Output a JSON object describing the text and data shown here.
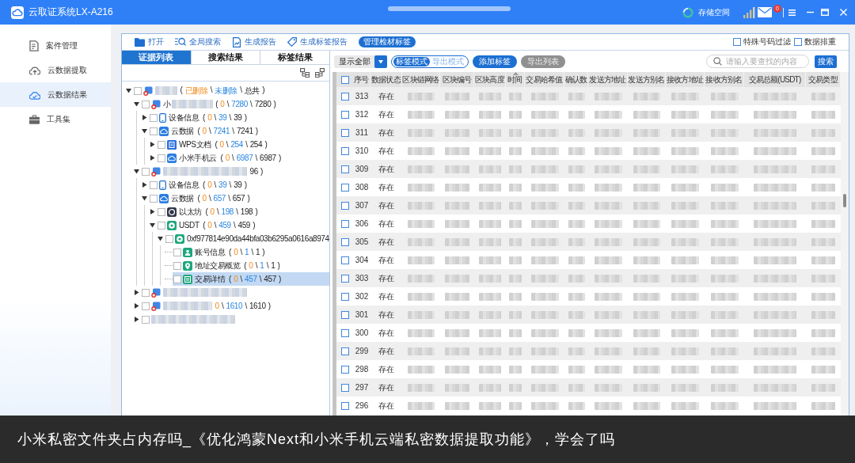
{
  "window": {
    "title": "云取证系统LX-A216",
    "storage_label": "存储空间",
    "mail_badge": "0"
  },
  "sidebar": {
    "items": [
      {
        "label": "案件管理",
        "kind": "case",
        "selected": false
      },
      {
        "label": "云数据提取",
        "kind": "upload",
        "selected": false
      },
      {
        "label": "云数据结果",
        "kind": "result",
        "selected": true
      },
      {
        "label": "工具集",
        "kind": "tools",
        "selected": false
      }
    ]
  },
  "toolbar": {
    "actions": [
      {
        "label": "打开",
        "kind": "open"
      },
      {
        "label": "全局搜索",
        "kind": "search"
      },
      {
        "label": "生成报告",
        "kind": "report"
      },
      {
        "label": "生成标签报告",
        "kind": "tag"
      }
    ],
    "tag_button": "管理检材标签",
    "options": [
      {
        "label": "特殊号码过滤",
        "checked": false
      },
      {
        "label": "数据排重",
        "checked": false
      }
    ]
  },
  "evidence_panel": {
    "tabs": [
      {
        "label": "证据列表",
        "selected": true
      },
      {
        "label": "搜索结果",
        "selected": false
      },
      {
        "label": "标签结果",
        "selected": false
      }
    ],
    "tree": [
      {
        "kind": "device",
        "redacted": true,
        "counts": [
          {
            "text": "(",
            "kind": "sep"
          },
          {
            "text": "已删除",
            "kind": "deleted"
          },
          {
            "text": "\\",
            "kind": "sep"
          },
          {
            "text": "未删除",
            "kind": "undeleted"
          },
          {
            "text": "\\",
            "kind": "sep"
          },
          {
            "text": "总共",
            "kind": "total"
          },
          {
            "text": ")",
            "kind": "sep"
          }
        ],
        "has_children": true,
        "expanded": true,
        "checked": false,
        "selected": false,
        "children": [
          {
            "kind": "device",
            "label": "小",
            "redacted": true,
            "counts": [
              {
                "text": "(",
                "kind": "sep"
              },
              {
                "text": "0",
                "kind": "deleted"
              },
              {
                "text": "\\",
                "kind": "sep"
              },
              {
                "text": "7280",
                "kind": "undeleted"
              },
              {
                "text": "\\",
                "kind": "sep"
              },
              {
                "text": "7280",
                "kind": "total"
              },
              {
                "text": ")",
                "kind": "sep"
              }
            ],
            "has_children": true,
            "expanded": true,
            "checked": false,
            "selected": false,
            "children": [
              {
                "kind": "phone",
                "label": "设备信息",
                "redacted": false,
                "counts": [
                  {
                    "text": "(",
                    "kind": "sep"
                  },
                  {
                    "text": "0",
                    "kind": "deleted"
                  },
                  {
                    "text": "\\",
                    "kind": "sep"
                  },
                  {
                    "text": "39",
                    "kind": "undeleted"
                  },
                  {
                    "text": "\\",
                    "kind": "sep"
                  },
                  {
                    "text": "39",
                    "kind": "total"
                  },
                  {
                    "text": ")",
                    "kind": "sep"
                  }
                ],
                "has_children": true,
                "expanded": false,
                "checked": false,
                "selected": false
              },
              {
                "kind": "cloud",
                "label": "云数据",
                "redacted": false,
                "counts": [
                  {
                    "text": "(",
                    "kind": "sep"
                  },
                  {
                    "text": "0",
                    "kind": "deleted"
                  },
                  {
                    "text": "\\",
                    "kind": "sep"
                  },
                  {
                    "text": "7241",
                    "kind": "undeleted"
                  },
                  {
                    "text": "\\",
                    "kind": "sep"
                  },
                  {
                    "text": "7241",
                    "kind": "total"
                  },
                  {
                    "text": ")",
                    "kind": "sep"
                  }
                ],
                "has_children": true,
                "expanded": true,
                "checked": false,
                "selected": false,
                "children": [
                  {
                    "kind": "document",
                    "label": "WPS文档",
                    "redacted": false,
                    "counts": [
                      {
                        "text": "(",
                        "kind": "sep"
                      },
                      {
                        "text": "0",
                        "kind": "deleted"
                      },
                      {
                        "text": "\\",
                        "kind": "sep"
                      },
                      {
                        "text": "254",
                        "kind": "undeleted"
                      },
                      {
                        "text": "\\",
                        "kind": "sep"
                      },
                      {
                        "text": "254",
                        "kind": "total"
                      },
                      {
                        "text": ")",
                        "kind": "sep"
                      }
                    ],
                    "has_children": true,
                    "expanded": false,
                    "checked": false,
                    "selected": false
                  },
                  {
                    "kind": "cloud",
                    "label": "小米手机云",
                    "redacted": false,
                    "counts": [
                      {
                        "text": "(",
                        "kind": "sep"
                      },
                      {
                        "text": "0",
                        "kind": "deleted"
                      },
                      {
                        "text": "\\",
                        "kind": "sep"
                      },
                      {
                        "text": "6987",
                        "kind": "undeleted"
                      },
                      {
                        "text": "\\",
                        "kind": "sep"
                      },
                      {
                        "text": "6987",
                        "kind": "total"
                      },
                      {
                        "text": ")",
                        "kind": "sep"
                      }
                    ],
                    "has_children": true,
                    "expanded": false,
                    "checked": false,
                    "selected": false
                  }
                ]
              }
            ]
          },
          {
            "kind": "device",
            "redacted": true,
            "counts": [
              {
                "text": "96",
                "kind": "total"
              },
              {
                "text": ")",
                "kind": "sep"
              }
            ],
            "has_children": true,
            "expanded": true,
            "checked": false,
            "selected": false,
            "children": [
              {
                "kind": "phone",
                "label": "设备信息",
                "redacted": false,
                "counts": [
                  {
                    "text": "(",
                    "kind": "sep"
                  },
                  {
                    "text": "0",
                    "kind": "deleted"
                  },
                  {
                    "text": "\\",
                    "kind": "sep"
                  },
                  {
                    "text": "39",
                    "kind": "undeleted"
                  },
                  {
                    "text": "\\",
                    "kind": "sep"
                  },
                  {
                    "text": "39",
                    "kind": "total"
                  },
                  {
                    "text": ")",
                    "kind": "sep"
                  }
                ],
                "has_children": true,
                "expanded": false,
                "checked": false,
                "selected": false
              },
              {
                "kind": "cloud",
                "label": "云数据",
                "redacted": false,
                "counts": [
                  {
                    "text": "(",
                    "kind": "sep"
                  },
                  {
                    "text": "0",
                    "kind": "deleted"
                  },
                  {
                    "text": "\\",
                    "kind": "sep"
                  },
                  {
                    "text": "657",
                    "kind": "undeleted"
                  },
                  {
                    "text": "\\",
                    "kind": "sep"
                  },
                  {
                    "text": "657",
                    "kind": "total"
                  },
                  {
                    "text": ")",
                    "kind": "sep"
                  }
                ],
                "has_children": true,
                "expanded": true,
                "checked": false,
                "selected": false,
                "children": [
                  {
                    "kind": "coin",
                    "label": "以太坊",
                    "redacted": false,
                    "counts": [
                      {
                        "text": "(",
                        "kind": "sep"
                      },
                      {
                        "text": "0",
                        "kind": "deleted"
                      },
                      {
                        "text": "\\",
                        "kind": "sep"
                      },
                      {
                        "text": "198",
                        "kind": "undeleted"
                      },
                      {
                        "text": "\\",
                        "kind": "sep"
                      },
                      {
                        "text": "198",
                        "kind": "total"
                      },
                      {
                        "text": ")",
                        "kind": "sep"
                      }
                    ],
                    "has_children": true,
                    "expanded": false,
                    "checked": false,
                    "selected": false
                  },
                  {
                    "kind": "token",
                    "label": "USDT",
                    "redacted": false,
                    "counts": [
                      {
                        "text": "(",
                        "kind": "sep"
                      },
                      {
                        "text": "0",
                        "kind": "deleted"
                      },
                      {
                        "text": "\\",
                        "kind": "sep"
                      },
                      {
                        "text": "459",
                        "kind": "undeleted"
                      },
                      {
                        "text": "\\",
                        "kind": "sep"
                      },
                      {
                        "text": "459",
                        "kind": "total"
                      },
                      {
                        "text": ")",
                        "kind": "sep"
                      }
                    ],
                    "has_children": true,
                    "expanded": true,
                    "checked": false,
                    "selected": false,
                    "children": [
                      {
                        "kind": "token",
                        "label": "0xf977814e90da44bfa03b6295a0616a8974",
                        "redacted": false,
                        "has_children": true,
                        "expanded": true,
                        "checked": false,
                        "selected": false,
                        "children": [
                          {
                            "kind": "account",
                            "label": "账号信息",
                            "redacted": false,
                            "counts": [
                              {
                                "text": "(",
                                "kind": "sep"
                              },
                              {
                                "text": "0",
                                "kind": "deleted"
                              },
                              {
                                "text": "\\",
                                "kind": "sep"
                              },
                              {
                                "text": "1",
                                "kind": "undeleted"
                              },
                              {
                                "text": "\\",
                                "kind": "sep"
                              },
                              {
                                "text": "1",
                                "kind": "total"
                              },
                              {
                                "text": ")",
                                "kind": "sep"
                              }
                            ],
                            "has_children": false,
                            "checked": false,
                            "selected": false
                          },
                          {
                            "kind": "pin",
                            "label": "地址交易概览",
                            "redacted": false,
                            "counts": [
                              {
                                "text": "(",
                                "kind": "sep"
                              },
                              {
                                "text": "0",
                                "kind": "deleted"
                              },
                              {
                                "text": "\\",
                                "kind": "sep"
                              },
                              {
                                "text": "1",
                                "kind": "undeleted"
                              },
                              {
                                "text": "\\",
                                "kind": "sep"
                              },
                              {
                                "text": "1",
                                "kind": "total"
                              },
                              {
                                "text": ")",
                                "kind": "sep"
                              }
                            ],
                            "has_children": false,
                            "checked": false,
                            "selected": false
                          },
                          {
                            "kind": "list",
                            "label": "交易详情",
                            "redacted": false,
                            "counts": [
                              {
                                "text": "(",
                                "kind": "sep"
                              },
                              {
                                "text": "0",
                                "kind": "deleted"
                              },
                              {
                                "text": "\\",
                                "kind": "sep"
                              },
                              {
                                "text": "457",
                                "kind": "undeleted"
                              },
                              {
                                "text": "\\",
                                "kind": "sep"
                              },
                              {
                                "text": "457",
                                "kind": "total"
                              },
                              {
                                "text": ")",
                                "kind": "sep"
                              }
                            ],
                            "has_children": false,
                            "checked": false,
                            "selected": true
                          }
                        ]
                      }
                    ]
                  }
                ]
              }
            ]
          },
          {
            "kind": "device",
            "redacted": true,
            "has_children": true,
            "expanded": false,
            "checked": false,
            "selected": false
          },
          {
            "kind": "device",
            "redacted": true,
            "counts": [
              {
                "text": "0",
                "kind": "deleted"
              },
              {
                "text": "\\",
                "kind": "sep"
              },
              {
                "text": "1610",
                "kind": "undeleted"
              },
              {
                "text": "\\",
                "kind": "sep"
              },
              {
                "text": "1610",
                "kind": "total"
              },
              {
                "text": ")",
                "kind": "sep"
              }
            ],
            "has_children": true,
            "expanded": false,
            "checked": false,
            "selected": false
          },
          {
            "kind": "hidden",
            "redacted": true,
            "has_children": true,
            "expanded": false,
            "checked": false,
            "selected": false
          }
        ]
      }
    ]
  },
  "results_panel": {
    "filter": {
      "value": "显示全部"
    },
    "modes": [
      {
        "label": "标签模式",
        "selected": true
      },
      {
        "label": "导出模式",
        "selected": false
      }
    ],
    "buttons": [
      {
        "label": "添加标签",
        "disabled": false
      },
      {
        "label": "导出列表",
        "disabled": true
      }
    ],
    "search": {
      "placeholder": "请输入要查找的内容",
      "button": "搜索"
    },
    "table": {
      "all_checked": false,
      "columns": [
        {
          "label": "序号",
          "sorted": false
        },
        {
          "label": "数据状态",
          "sorted": false
        },
        {
          "label": "区块链网络",
          "sorted": false
        },
        {
          "label": "区块编号",
          "sorted": false
        },
        {
          "label": "区块高度",
          "sorted": false
        },
        {
          "label": "时间",
          "sorted": true
        },
        {
          "label": "交易哈希值",
          "sorted": false
        },
        {
          "label": "确认数",
          "sorted": false
        },
        {
          "label": "发送方地址",
          "sorted": false
        },
        {
          "label": "发送方别名",
          "sorted": false
        },
        {
          "label": "接收方地址",
          "sorted": false
        },
        {
          "label": "接收方别名",
          "sorted": false
        },
        {
          "label": "交易总额(USDT)",
          "sorted": false
        },
        {
          "label": "交易类型",
          "sorted": false
        }
      ],
      "rows": [
        {
          "seq": "313",
          "status": "存在",
          "checked": false,
          "redacted": true
        },
        {
          "seq": "312",
          "status": "存在",
          "checked": false,
          "redacted": true
        },
        {
          "seq": "311",
          "status": "存在",
          "checked": false,
          "redacted": true
        },
        {
          "seq": "310",
          "status": "存在",
          "checked": false,
          "redacted": true
        },
        {
          "seq": "309",
          "status": "存在",
          "checked": false,
          "redacted": true
        },
        {
          "seq": "308",
          "status": "存在",
          "checked": false,
          "redacted": true
        },
        {
          "seq": "307",
          "status": "存在",
          "checked": false,
          "redacted": true
        },
        {
          "seq": "306",
          "status": "存在",
          "checked": false,
          "redacted": true
        },
        {
          "seq": "305",
          "status": "存在",
          "checked": false,
          "redacted": true
        },
        {
          "seq": "304",
          "status": "存在",
          "checked": false,
          "redacted": true
        },
        {
          "seq": "303",
          "status": "存在",
          "checked": false,
          "redacted": true
        },
        {
          "seq": "302",
          "status": "存在",
          "checked": false,
          "redacted": true
        },
        {
          "seq": "301",
          "status": "存在",
          "checked": false,
          "redacted": true
        },
        {
          "seq": "300",
          "status": "存在",
          "checked": false,
          "redacted": true
        },
        {
          "seq": "299",
          "status": "存在",
          "checked": false,
          "redacted": true
        },
        {
          "seq": "298",
          "status": "存在",
          "checked": false,
          "redacted": true
        },
        {
          "seq": "297",
          "status": "存在",
          "checked": false,
          "redacted": true
        },
        {
          "seq": "296",
          "status": "存在",
          "checked": false,
          "redacted": true
        }
      ]
    }
  },
  "caption": "小米私密文件夹占内存吗_《优化鸿蒙Next和小米手机云端私密数据提取功能》，学会了吗"
}
